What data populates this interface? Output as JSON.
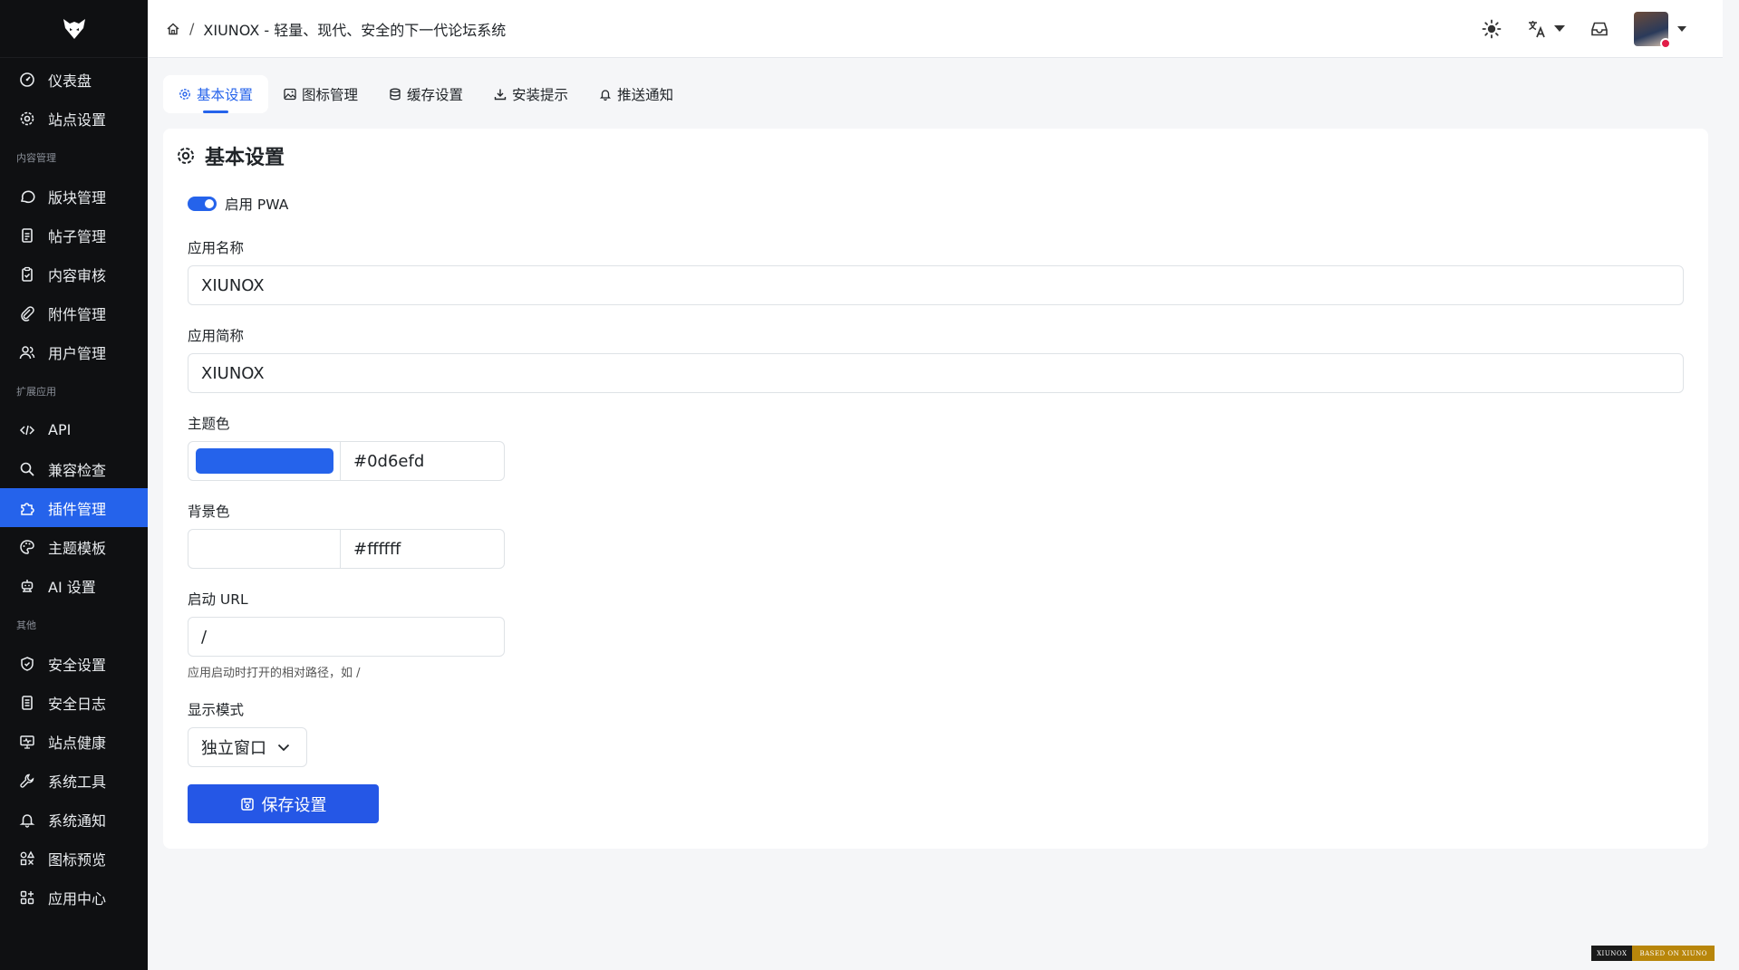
{
  "sidebar": {
    "items_top": [
      {
        "label": "仪表盘",
        "icon": "dashboard-icon"
      },
      {
        "label": "站点设置",
        "icon": "gear-icon"
      }
    ],
    "section_content": "内容管理",
    "items_content": [
      {
        "label": "版块管理",
        "icon": "chat-bubble-icon"
      },
      {
        "label": "帖子管理",
        "icon": "document-icon"
      },
      {
        "label": "内容审核",
        "icon": "clipboard-check-icon"
      },
      {
        "label": "附件管理",
        "icon": "paperclip-icon"
      },
      {
        "label": "用户管理",
        "icon": "users-icon"
      }
    ],
    "section_ext": "扩展应用",
    "items_ext": [
      {
        "label": "API",
        "icon": "code-icon"
      },
      {
        "label": "兼容检查",
        "icon": "search-icon"
      },
      {
        "label": "插件管理",
        "icon": "puzzle-icon",
        "active": true
      },
      {
        "label": "主题模板",
        "icon": "palette-icon"
      },
      {
        "label": "AI 设置",
        "icon": "robot-icon"
      }
    ],
    "section_other": "其他",
    "items_other": [
      {
        "label": "安全设置",
        "icon": "shield-icon"
      },
      {
        "label": "安全日志",
        "icon": "log-document-icon"
      },
      {
        "label": "站点健康",
        "icon": "monitor-pulse-icon"
      },
      {
        "label": "系统工具",
        "icon": "wrench-icon"
      },
      {
        "label": "系统通知",
        "icon": "bell-icon"
      },
      {
        "label": "图标预览",
        "icon": "shapes-icon"
      },
      {
        "label": "应用中心",
        "icon": "apps-grid-icon"
      }
    ]
  },
  "header": {
    "breadcrumb_sep": "/",
    "breadcrumb_title": "XIUNOX - 轻量、现代、安全的下一代论坛系统"
  },
  "tabs": [
    {
      "label": "基本设置",
      "icon": "gear-icon",
      "active": true
    },
    {
      "label": "图标管理",
      "icon": "image-icon"
    },
    {
      "label": "缓存设置",
      "icon": "database-icon"
    },
    {
      "label": "安装提示",
      "icon": "download-icon"
    },
    {
      "label": "推送通知",
      "icon": "bell-icon"
    }
  ],
  "form": {
    "title": "基本设置",
    "pwa_label": "启用 PWA",
    "pwa_enabled": true,
    "app_name_label": "应用名称",
    "app_name_value": "XIUNOX",
    "short_name_label": "应用简称",
    "short_name_value": "XIUNOX",
    "theme_color_label": "主题色",
    "theme_color_value": "#0d6efd",
    "theme_swatch": "#2563eb",
    "bg_color_label": "背景色",
    "bg_color_value": "#ffffff",
    "start_url_label": "启动 URL",
    "start_url_value": "/",
    "start_url_help": "应用启动时打开的相对路径，如 /",
    "display_label": "显示模式",
    "display_value": "独立窗口",
    "save_label": "保存设置"
  },
  "footer_badge": {
    "left": "XIUNOX",
    "right": "BASED ON XIUNO"
  },
  "colors": {
    "accent": "#2563eb",
    "sidebar_bg": "#0f1012"
  }
}
